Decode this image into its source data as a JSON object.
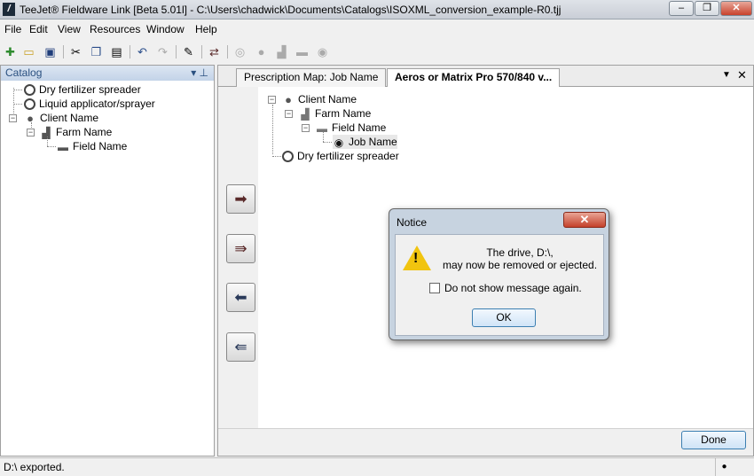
{
  "window": {
    "app_icon": "/",
    "title": "TeeJet® Fieldware Link [Beta 5.01l] - C:\\Users\\chadwick\\Documents\\Catalogs\\ISOXML_conversion_example-R0.tjj",
    "minimize": "–",
    "maximize": "❐",
    "close": "✕"
  },
  "menu": [
    "File",
    "Edit",
    "View",
    "Resources",
    "Window",
    "Help"
  ],
  "toolbar_icons": [
    "new-icon",
    "open-icon",
    "save-icon",
    "cut-icon",
    "copy-icon",
    "paste-icon",
    "undo-icon",
    "redo-icon",
    "edit-icon",
    "transfer-icon",
    "wheel-icon",
    "client-icon",
    "farm-icon",
    "field-icon",
    "disc-icon"
  ],
  "catalog": {
    "header": "Catalog",
    "pin": "▾ ⊥",
    "items": [
      {
        "label": "Dry fertilizer spreader"
      },
      {
        "label": "Liquid applicator/sprayer"
      },
      {
        "label": "Client Name"
      },
      {
        "label": "Farm Name"
      },
      {
        "label": "Field Name"
      }
    ]
  },
  "tabs": [
    {
      "label": "Prescription Map: Job Name"
    },
    {
      "label": "Aeros or Matrix Pro 570/840 v..."
    }
  ],
  "tab_controls": {
    "dropdown": "▼",
    "close": "✕"
  },
  "job_tree": [
    {
      "label": "Client Name"
    },
    {
      "label": "Farm Name"
    },
    {
      "label": "Field Name"
    },
    {
      "label": "Job Name"
    },
    {
      "label": "Dry fertilizer spreader"
    }
  ],
  "done_button": "Done",
  "status": {
    "text": "D:\\ exported.",
    "indicator": "●"
  },
  "dialog": {
    "title": "Notice",
    "close": "✕",
    "message_line1": "The drive, D:\\,",
    "message_line2": "may now be removed or ejected.",
    "checkbox_label": "Do not show message again.",
    "checkbox_checked": false,
    "ok": "OK"
  },
  "colors": {
    "catalog_header_text": "#2a5080",
    "close_button": "#c4412b",
    "warning": "#f1c40f"
  }
}
